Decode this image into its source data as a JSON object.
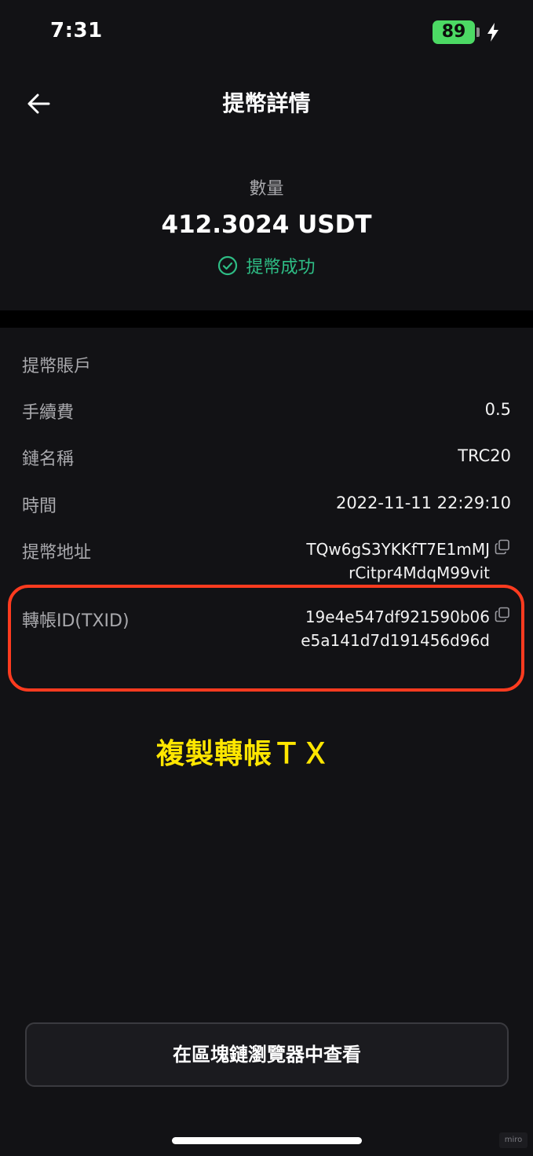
{
  "status_bar": {
    "time": "7:31",
    "battery": "89"
  },
  "header": {
    "title": "提幣詳情"
  },
  "summary": {
    "amount_label": "數量",
    "amount_value": "412.3024 USDT",
    "status": "提幣成功"
  },
  "details": {
    "account": {
      "label": "提幣賬戶",
      "value": ""
    },
    "fee": {
      "label": "手續費",
      "value": "0.5"
    },
    "chain": {
      "label": "鏈名稱",
      "value": "TRC20"
    },
    "time": {
      "label": "時間",
      "value": "2022-11-11 22:29:10"
    },
    "address": {
      "label": "提幣地址",
      "line1": "TQw6gS3YKKfT7E1mMJ",
      "line2": "rCitpr4MdqM99vit"
    },
    "txid": {
      "label": "轉帳ID(TXID)",
      "line1": "19e4e547df921590b06",
      "line2": "e5a141d7d191456d96d"
    }
  },
  "annotation": "複製轉帳ＴＸ",
  "footer": {
    "explorer_button": "在區塊鏈瀏覽器中查看"
  },
  "watermark": "miro",
  "colors": {
    "background": "#121215",
    "success": "#2ebd85",
    "highlight": "#ff3b1f",
    "annotation": "#ffe600",
    "battery": "#4cd964"
  }
}
